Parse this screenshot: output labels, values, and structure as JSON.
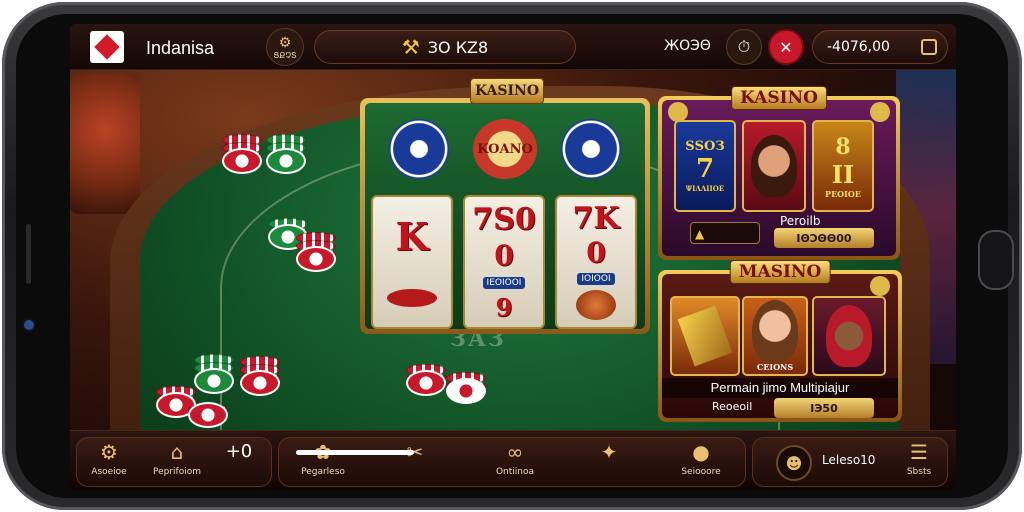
{
  "topbar": {
    "brand": "Indanisa",
    "badge_label": "ՑՔՉՏ",
    "center_amount": "ЗО КZ8",
    "right_amount_label": "ЖОЭΘ",
    "balance": "-4076,00"
  },
  "table": {
    "felt_text": "ЗАЗ"
  },
  "slot_machine": {
    "title": "KASINO",
    "top_symbols": [
      "chip-blue",
      "KOANO",
      "chip-blue"
    ],
    "reels": [
      {
        "symbol": "K",
        "sub": ""
      },
      {
        "symbol": "7Ѕ0",
        "sub": "ΙΕΟΙΟΟΙ"
      },
      {
        "symbol": "7K",
        "sub": "ΙΟΙΟΟΙ"
      }
    ],
    "bottom_symbols": [
      "",
      "9",
      ""
    ]
  },
  "card1": {
    "title": "KASINO",
    "tile1_text": "ЅЅОЗ",
    "tile1_big": "7",
    "tile1_sub": "ΨΙΛΛΙΙΟΕ",
    "tile3_text": "8",
    "tile3_big": "ΙΙ",
    "tile3_sub": "ΡΕΟΙΟΕ",
    "label": "Peroilb",
    "value": "ΙΘϽΘΘ00"
  },
  "card2": {
    "title": "MASINO",
    "tile1_sub": "CEIONS",
    "caption": "Permain jimo Multipiajur",
    "left_label": "Reoeoil",
    "value": "ІЭ50"
  },
  "bottombar": {
    "items": [
      {
        "label": "Asoeioe",
        "icon": "gear"
      },
      {
        "label": "Peprifoiom",
        "icon": "bell"
      },
      {
        "label": "",
        "icon": "+0"
      },
      {
        "label": "Pegarleso",
        "icon": "cog"
      },
      {
        "label": "",
        "icon": "tools"
      },
      {
        "label": "Ontiinoa",
        "icon": "link"
      },
      {
        "label": "",
        "icon": "sparkle"
      },
      {
        "label": "Seiooore",
        "icon": "coin"
      },
      {
        "label": "Leleso10",
        "icon": "user"
      },
      {
        "label": "Sbsts",
        "icon": "menu"
      }
    ]
  },
  "colors": {
    "felt": "#1f7a3c",
    "gold": "#f2cc5a",
    "chip_red": "#c8192c",
    "chip_green": "#1b8a3a",
    "close_btn": "#c8192c"
  }
}
